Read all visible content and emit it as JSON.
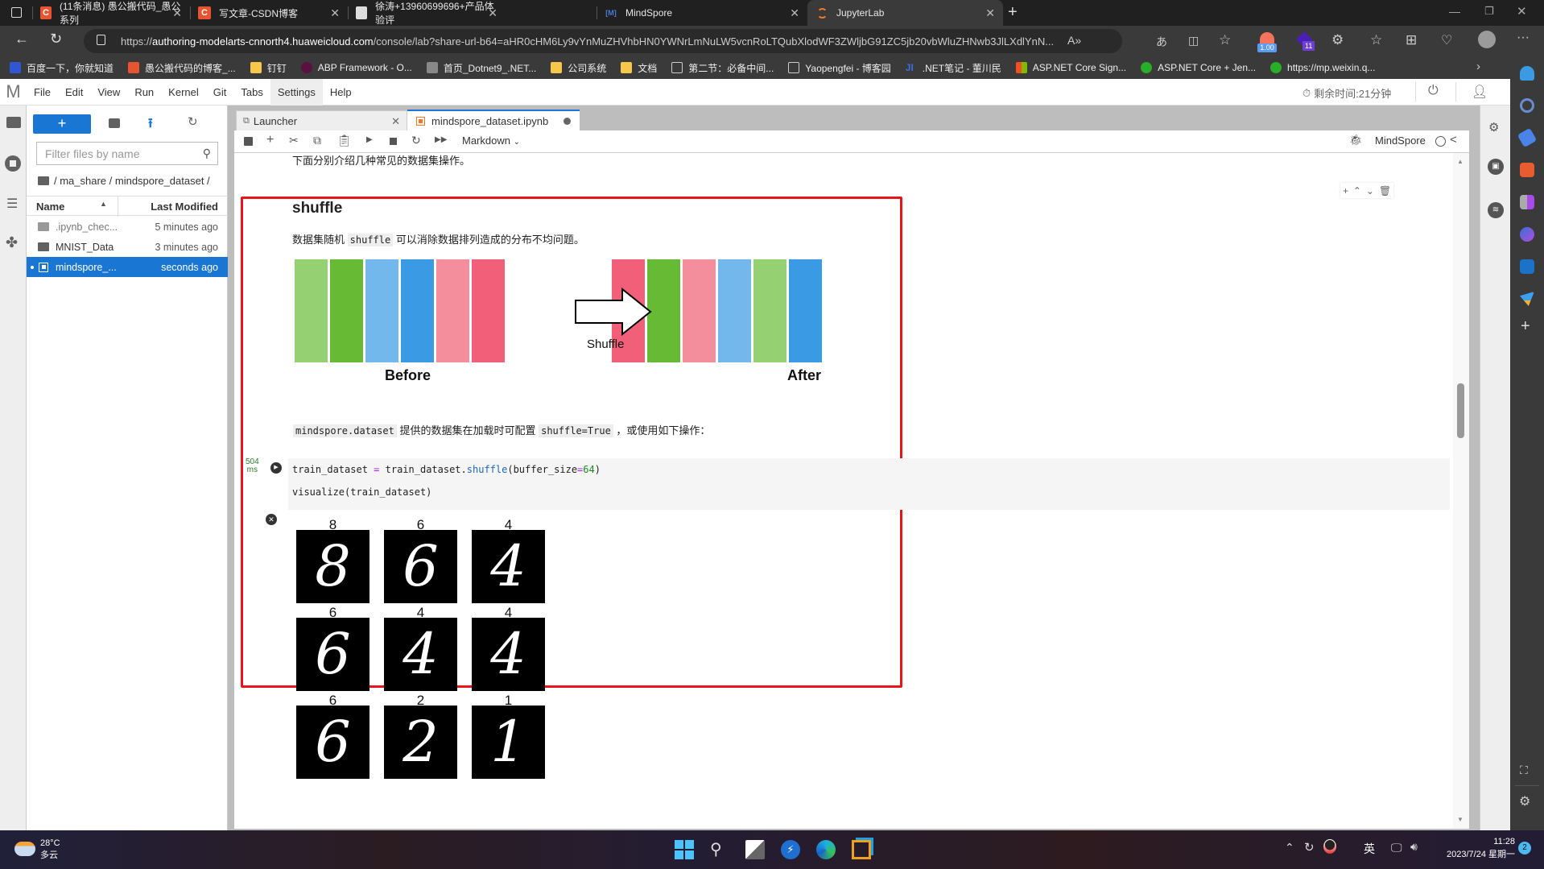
{
  "browser": {
    "tabs": [
      {
        "title": "(11条消息) 愚公搬代码_愚公系列",
        "icon": "csdn-icon",
        "active": false
      },
      {
        "title": "写文章-CSDN博客",
        "icon": "csdn-icon",
        "active": false
      },
      {
        "title": "徐涛+13960699696+产品体验评",
        "icon": "doc-icon",
        "active": false
      },
      {
        "title": "MindSpore",
        "icon": "mindspore-icon",
        "active": false
      },
      {
        "title": "JupyterLab",
        "icon": "jupyter-icon",
        "active": true
      }
    ],
    "url_prefix": "https://",
    "url_host": "authoring-modelarts-cnnorth4.huaweicloud.com",
    "url_path": "/console/lab?share-url-b64=aHR0cHM6Ly9vYnMuZHVhbHN0YWNrLmNuLW5vcnRoLTQubXlodWF3ZWljbG91ZC5jb20vbWluZHNwb3JlLXdlYnN...",
    "extension_badges": {
      "price": "1.00",
      "count": "11"
    },
    "bookmarks": [
      "百度一下，你就知道",
      "愚公搬代码的博客_...",
      "钉钉",
      "ABP Framework - O...",
      "首页_Dotnet9_.NET...",
      "公司系统",
      "文档",
      "第二节：必备中间...",
      "Yaopengfei - 博客园",
      ".NET笔记 - 董川民",
      "ASP.NET Core Sign...",
      "ASP.NET Core + Jen...",
      "https://mp.weixin.q..."
    ]
  },
  "jupyter": {
    "menu": [
      "File",
      "Edit",
      "View",
      "Run",
      "Kernel",
      "Git",
      "Tabs",
      "Settings",
      "Help"
    ],
    "highlighted_menu": "Settings",
    "remaining_time": "剩余时间:21分钟",
    "filebrowser": {
      "new_button": "+",
      "filter_placeholder": "Filter files by name",
      "breadcrumb": "/ ma_share / mindspore_dataset /",
      "col_name": "Name",
      "col_modified": "Last Modified",
      "files": [
        {
          "name": ".ipynb_chec...",
          "modified": "5 minutes ago",
          "type": "folder",
          "selected": false
        },
        {
          "name": "MNIST_Data",
          "modified": "3 minutes ago",
          "type": "folder",
          "selected": false
        },
        {
          "name": "mindspore_...",
          "modified": "seconds ago",
          "type": "notebook",
          "selected": true
        }
      ]
    },
    "doc_tabs": [
      {
        "label": "Launcher",
        "active": false
      },
      {
        "label": "mindspore_dataset.ipynb",
        "active": true,
        "unsaved": true
      }
    ],
    "cell_type": "Markdown",
    "kernel_name": "MindSpore",
    "notebook": {
      "intro_text": "下面分别介绍几种常见的数据集操作。",
      "heading": "shuffle",
      "desc_pre": "数据集随机",
      "desc_code": "shuffle",
      "desc_post": "可以消除数据排列造成的分布不均问题。",
      "diagram": {
        "before_colors": [
          "#95d072",
          "#67ba34",
          "#72b8ec",
          "#3a9ae4",
          "#f48d9c",
          "#f16078"
        ],
        "after_colors": [
          "#f16078",
          "#67ba34",
          "#f48d9c",
          "#72b8ec",
          "#95d072",
          "#3a9ae4"
        ],
        "arrow_label": "Shuffle",
        "before_label": "Before",
        "after_label": "After"
      },
      "config_code1": "mindspore.dataset",
      "config_text": "提供的数据集在加载时可配置",
      "config_code2": "shuffle=True",
      "config_tail": "，或使用如下操作：",
      "exec_time": "504",
      "exec_unit": "ms",
      "code_line1": {
        "a": "train_dataset ",
        "op": "=",
        "b": " train_dataset.",
        "fn": "shuffle",
        "c": "(buffer_size",
        "eq": "=",
        "num": "64",
        "d": ")"
      },
      "code_line2": "visualize(train_dataset)",
      "output_labels": [
        "8",
        "6",
        "4",
        "6",
        "4",
        "4",
        "6",
        "2",
        "1"
      ]
    }
  },
  "taskbar": {
    "weather_temp": "28°C",
    "weather_desc": "多云",
    "ime": "英",
    "time": "11:28",
    "date": "2023/7/24 星期一",
    "notifications": "2"
  }
}
